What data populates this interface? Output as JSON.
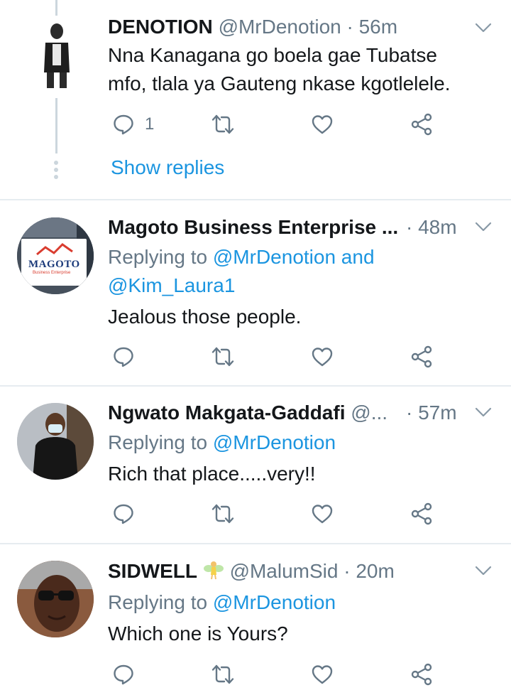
{
  "tweets": [
    {
      "name": "DENOTION",
      "handle": "@MrDenotion",
      "time": "· 56m",
      "text_line1": "Nna Kanagana go boela gae Tubatse",
      "text_line2": "mfo, tlala ya Gauteng nkase kgotlelele.",
      "reply_count": "1",
      "show_replies": "Show replies"
    },
    {
      "name": "Magoto Business Enterprise ...",
      "handle": "",
      "time": "· 48m",
      "replying_prefix": "Replying to ",
      "replying_line1_link": "@MrDenotion and",
      "replying_line2_link": "@Kim_Laura1",
      "text": "Jealous those people.",
      "avatar_logo_text": "MAGOTO",
      "avatar_logo_sub": "Business Enterprise"
    },
    {
      "name": "Ngwato Makgata-Gaddafi",
      "handle": "@...",
      "time": "· 57m",
      "replying_prefix": "Replying to ",
      "replying_link": "@MrDenotion",
      "text": "Rich that place.....very!!"
    },
    {
      "name": "SIDWELL",
      "emoji_icon": "fairy-emoji",
      "handle": "@MalumSid",
      "time": "· 20m",
      "replying_prefix": "Replying to ",
      "replying_link": "@MrDenotion",
      "text": "Which one is Yours?"
    }
  ],
  "colors": {
    "link": "#1b95e0",
    "secondary": "#657786",
    "divider": "#e6ecf0"
  }
}
